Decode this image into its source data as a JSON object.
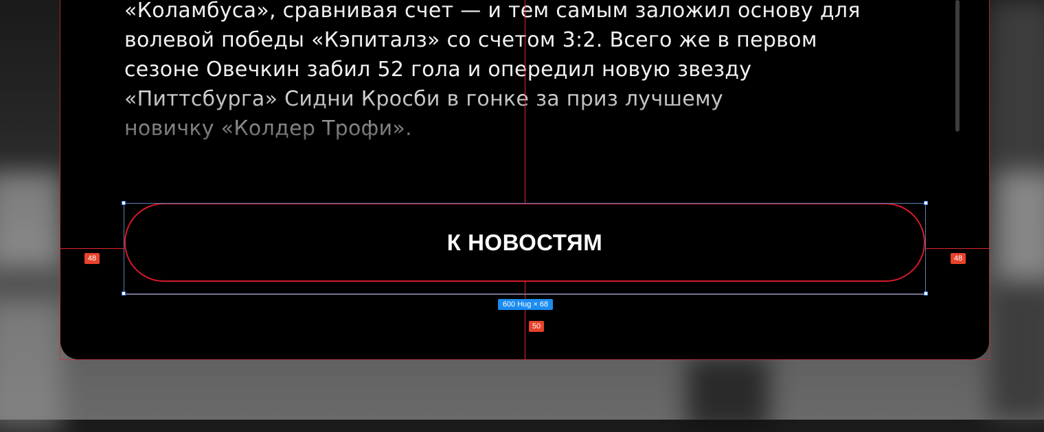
{
  "article": {
    "lines": [
      "«Коламбуса», сравнивая счет — и тем самым заложил основу для",
      "волевой победы «Кэпиталз» со счетом 3:2. Всего же в первом",
      "сезоне Овечкин забил 52 гола и опередил новую звезду",
      "«Питтсбурга» Сидни Кросби в гонке за приз лучшему",
      "новичку «Колдер Трофи»."
    ]
  },
  "button": {
    "label": "К НОВОСТЯМ",
    "border_color": "#d7192a"
  },
  "overlay": {
    "padding_left_label": "48",
    "padding_right_label": "48",
    "size_label": "600 Hug × 68",
    "gap_bottom_label": "50",
    "guide_color": "#e0262f",
    "selection_color": "#1b8cf2"
  }
}
